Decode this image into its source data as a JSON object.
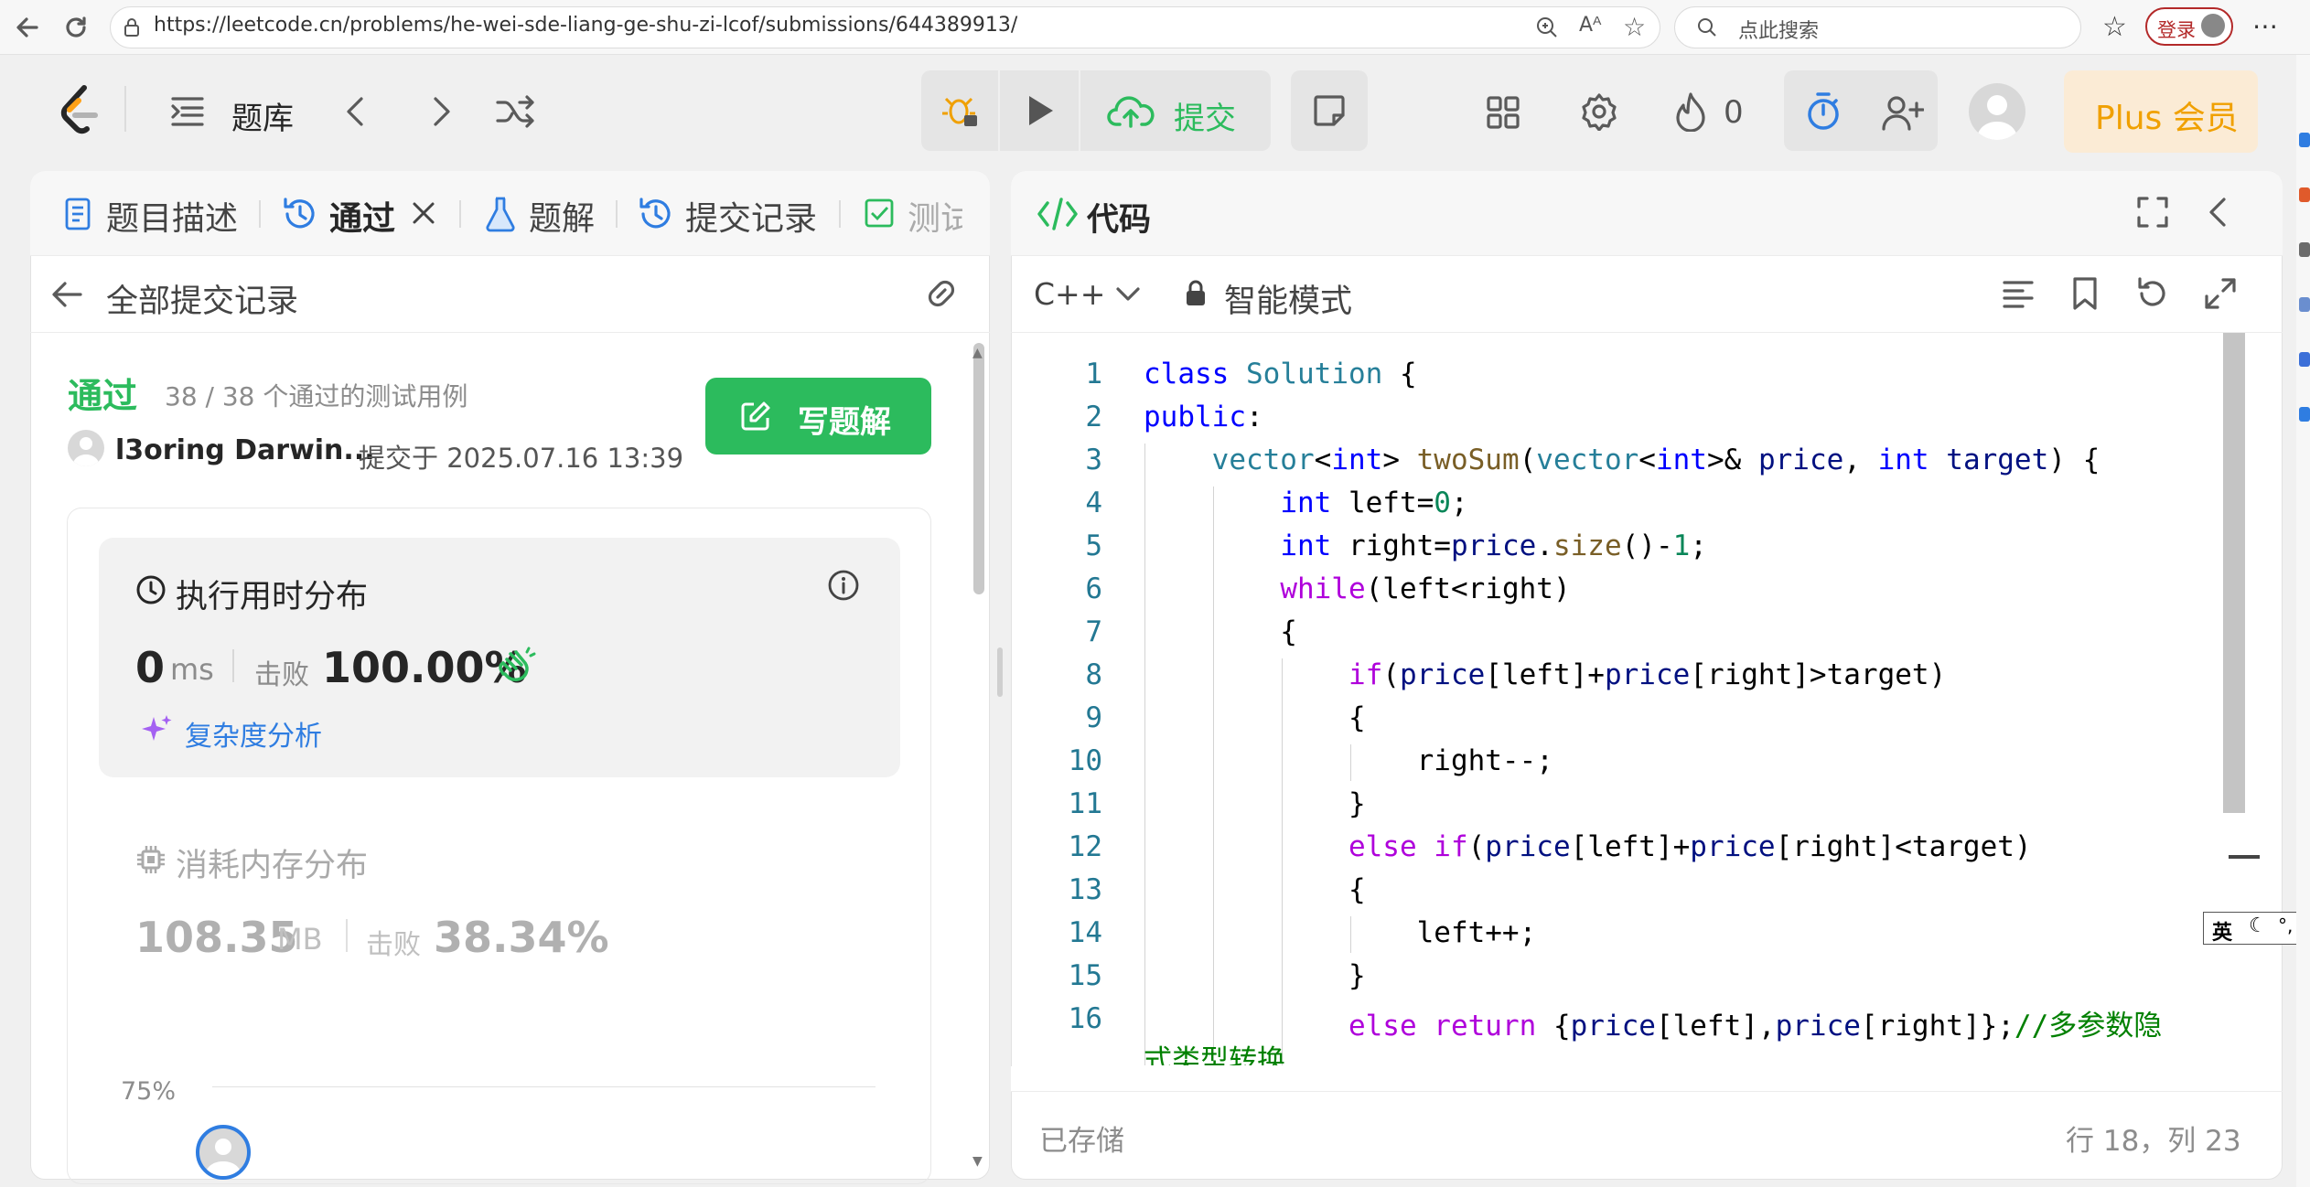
{
  "browser": {
    "url": "https://leetcode.cn/problems/he-wei-sde-liang-ge-shu-zi-lcof/submissions/644389913/",
    "search_placeholder": "点此搜索",
    "login_label": "登录"
  },
  "header": {
    "library_label": "题库",
    "submit_label": "提交",
    "streak_count": "0",
    "plus_label": "Plus 会员"
  },
  "left_tabs": [
    {
      "label": "题目描述"
    },
    {
      "label": "通过"
    },
    {
      "label": "题解"
    },
    {
      "label": "提交记录"
    },
    {
      "label": "测试"
    }
  ],
  "submission": {
    "back_label": "全部提交记录",
    "status": "通过",
    "testcases": "38 / 38 个通过的测试用例",
    "user": "l3oring Darwin...",
    "submitted_at": "提交于 2025.07.16 13:39",
    "write_solution_label": "写题解",
    "runtime": {
      "title": "执行用时分布",
      "value": "0",
      "unit": "ms",
      "beats_label": "击败",
      "beats": "100.00%",
      "analysis_label": "复杂度分析"
    },
    "memory": {
      "title": "消耗内存分布",
      "value": "108.35",
      "unit": "MB",
      "beats_label": "击败",
      "beats": "38.34%"
    },
    "chart": {
      "y_tick": "75%"
    }
  },
  "editor": {
    "title": "代码",
    "language": "C++",
    "mode_label": "智能模式",
    "status_saved": "已存储",
    "cursor_pos": "行 18，列 23",
    "ime_indicator": "英",
    "line_numbers": [
      "1",
      "2",
      "3",
      "4",
      "5",
      "6",
      "7",
      "8",
      "9",
      "10",
      "11",
      "12",
      "13",
      "14",
      "15",
      "16"
    ],
    "overflow_text": "式类型转换"
  },
  "colors": {
    "accent_green": "#2cbb5d",
    "plus_gold": "#f0a000",
    "link_blue": "#2f7de1"
  }
}
